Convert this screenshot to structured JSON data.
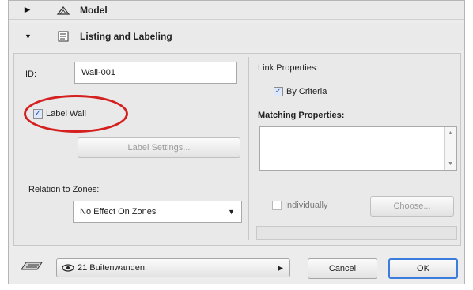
{
  "sections": {
    "model": {
      "label": "Model"
    },
    "listing": {
      "label": "Listing and Labeling"
    }
  },
  "left": {
    "id_label": "ID:",
    "id_value": "Wall-001",
    "label_wall": {
      "label": "Label Wall",
      "checked": true
    },
    "label_settings_button": "Label Settings...",
    "relation_label": "Relation to Zones:",
    "relation_select": "No Effect On Zones"
  },
  "right": {
    "link_properties_label": "Link Properties:",
    "by_criteria": {
      "label": "By Criteria",
      "checked": true
    },
    "matching_properties_label": "Matching Properties:",
    "individually": {
      "label": "Individually",
      "checked": false
    },
    "choose_button": "Choose..."
  },
  "footer": {
    "layer_select": "21 Buitenwanden",
    "cancel_button": "Cancel",
    "ok_button": "OK"
  },
  "icons": {
    "model_icon": "model-section-icon",
    "listing_icon": "listing-labeling-icon",
    "layer_icon": "layer-icon",
    "eye_icon": "eye-icon"
  },
  "colors": {
    "highlight_oval": "#d52020",
    "ok_border": "#3b7ddd"
  }
}
